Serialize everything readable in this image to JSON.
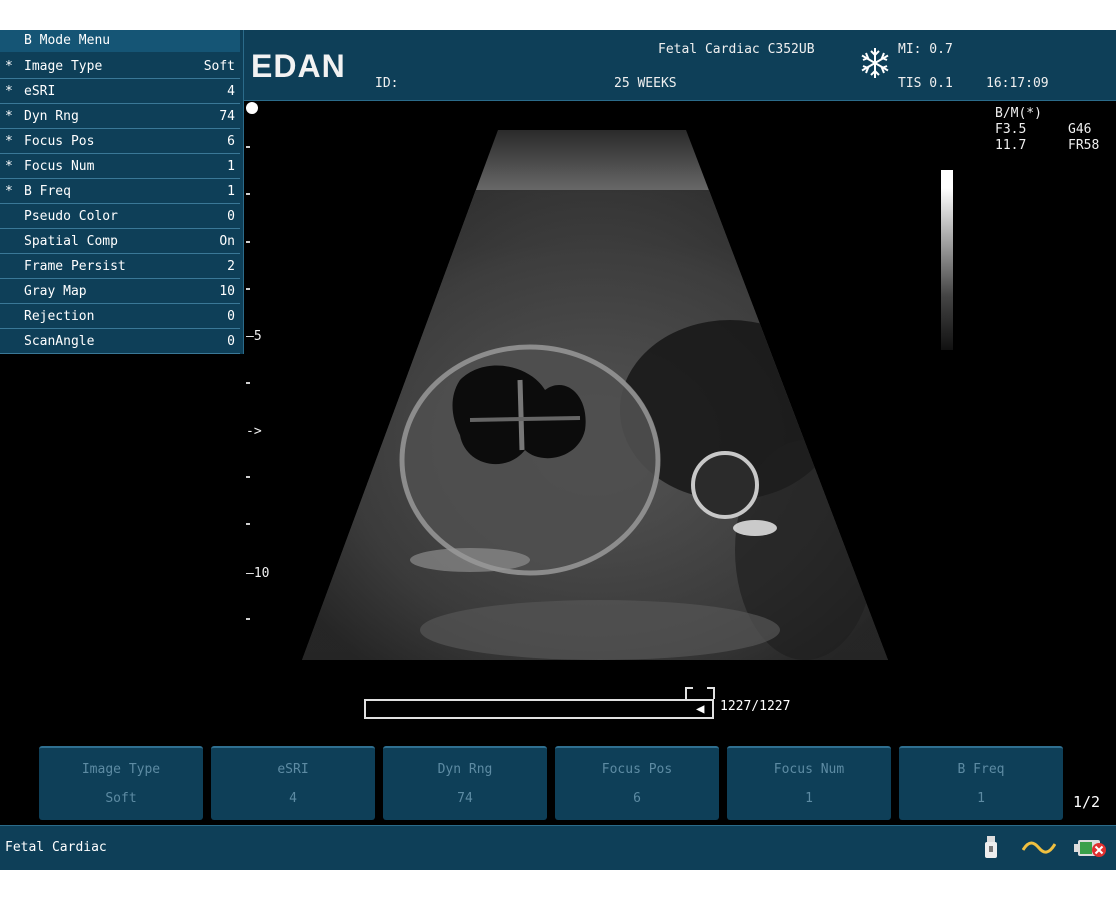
{
  "header": {
    "brand": "EDAN",
    "id_label": "ID:",
    "exam_probe": "Fetal  Cardiac  C352UB",
    "weeks": "25  WEEKS",
    "mi": "MI: 0.7",
    "tis": "TIS 0.1",
    "time": "16:17:09"
  },
  "menu": {
    "title": "B  Mode  Menu",
    "items": [
      {
        "star": "*",
        "label": "Image  Type",
        "value": "Soft"
      },
      {
        "star": "*",
        "label": "eSRI",
        "value": "4"
      },
      {
        "star": "*",
        "label": "Dyn  Rng",
        "value": "74"
      },
      {
        "star": "*",
        "label": "Focus  Pos",
        "value": "6"
      },
      {
        "star": "*",
        "label": "Focus  Num",
        "value": "1"
      },
      {
        "star": "*",
        "label": "B  Freq",
        "value": "1"
      },
      {
        "star": "",
        "label": "Pseudo  Color",
        "value": "0"
      },
      {
        "star": "",
        "label": "Spatial  Comp",
        "value": "On"
      },
      {
        "star": "",
        "label": "Frame  Persist",
        "value": "2"
      },
      {
        "star": "",
        "label": "Gray  Map",
        "value": "10"
      },
      {
        "star": "",
        "label": "Rejection",
        "value": "0"
      },
      {
        "star": "",
        "label": "ScanAngle",
        "value": "0"
      }
    ]
  },
  "scale": {
    "mark5": "5",
    "mark10": "10",
    "focus_marker": "->"
  },
  "info": {
    "mode": "B/M(*)",
    "freq": "F3.5",
    "gain": "G46",
    "depth": "11.7",
    "frame_rate": "FR58"
  },
  "cine": {
    "counter": "1227/1227",
    "position": 1.0
  },
  "softkeys": [
    {
      "label": "Image  Type",
      "value": "Soft"
    },
    {
      "label": "eSRI",
      "value": "4"
    },
    {
      "label": "Dyn  Rng",
      "value": "74"
    },
    {
      "label": "Focus  Pos",
      "value": "6"
    },
    {
      "label": "Focus  Num",
      "value": "1"
    },
    {
      "label": "B  Freq",
      "value": "1"
    }
  ],
  "page_indicator": "1/2",
  "status": {
    "exam_name": "Fetal  Cardiac"
  },
  "icons": [
    "snowflake-icon",
    "usb-icon",
    "ecg-wave-icon",
    "battery-error-icon"
  ],
  "colors": {
    "panel": "#0e3f58",
    "accent": "#f0c040",
    "error": "#e03030"
  }
}
